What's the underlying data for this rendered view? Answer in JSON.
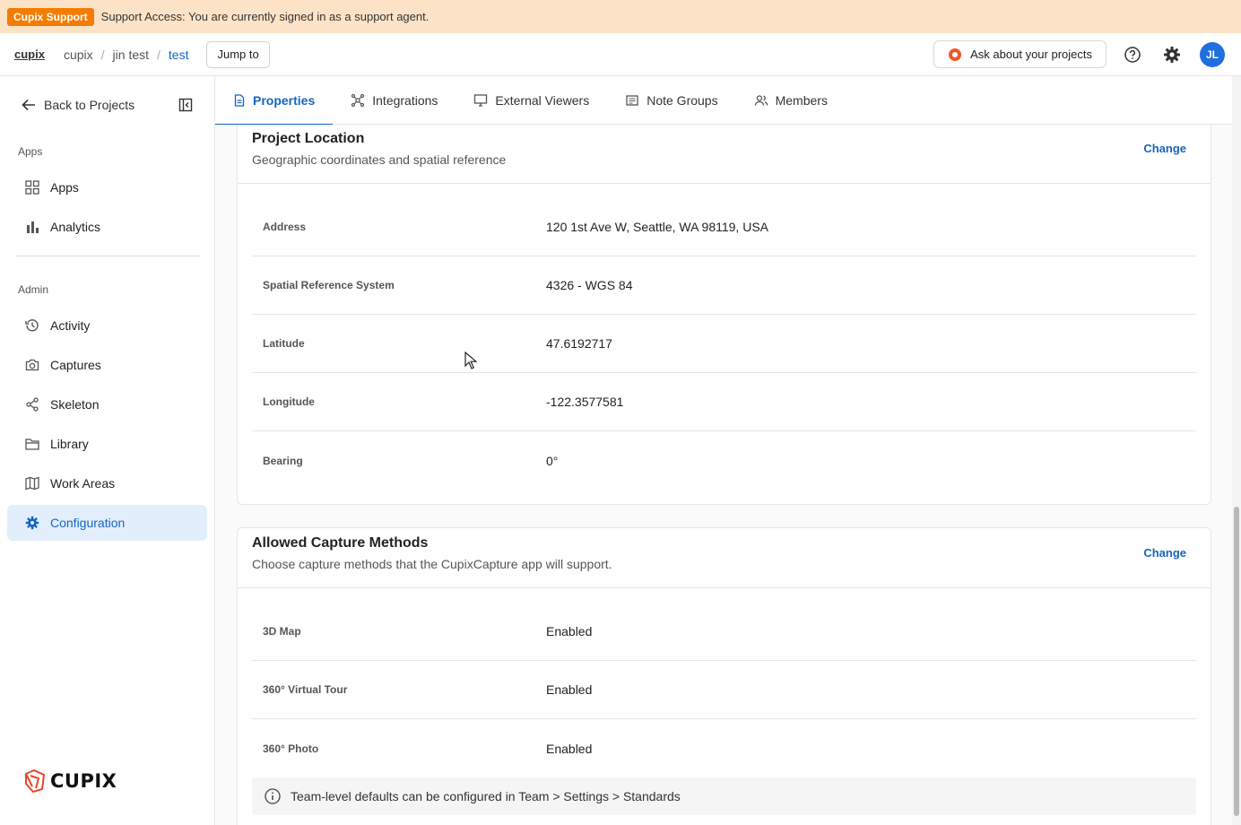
{
  "banner": {
    "badge": "Cupix Support",
    "message": "Support Access: You are currently signed in as a support agent."
  },
  "topnav": {
    "org_link": "cupix",
    "breadcrumbs": [
      "cupix",
      "jin test",
      "test"
    ],
    "jump_label": "Jump to",
    "ask_label": "Ask about your projects",
    "avatar_initials": "JL"
  },
  "sidebar": {
    "back_label": "Back to Projects",
    "apps_section": "Apps",
    "admin_section": "Admin",
    "items": [
      {
        "label": "Apps",
        "icon": "grid-icon"
      },
      {
        "label": "Analytics",
        "icon": "bar-chart-icon"
      },
      {
        "label": "Activity",
        "icon": "history-icon"
      },
      {
        "label": "Captures",
        "icon": "camera-icon"
      },
      {
        "label": "Skeleton",
        "icon": "share-nodes-icon"
      },
      {
        "label": "Library",
        "icon": "folder-icon"
      },
      {
        "label": "Work Areas",
        "icon": "map-icon"
      },
      {
        "label": "Configuration",
        "icon": "gear-icon"
      }
    ],
    "logo_text": "CUPIX"
  },
  "tabs": [
    {
      "label": "Properties",
      "icon": "document-icon"
    },
    {
      "label": "Integrations",
      "icon": "hub-icon"
    },
    {
      "label": "External Viewers",
      "icon": "monitor-icon"
    },
    {
      "label": "Note Groups",
      "icon": "notes-icon"
    },
    {
      "label": "Members",
      "icon": "people-icon"
    }
  ],
  "location": {
    "title": "Project Location",
    "subtitle": "Geographic coordinates and spatial reference",
    "change_label": "Change",
    "rows": [
      {
        "label": "Address",
        "value": "120 1st Ave W, Seattle, WA 98119, USA"
      },
      {
        "label": "Spatial Reference System",
        "value": "4326 - WGS 84"
      },
      {
        "label": "Latitude",
        "value": "47.6192717"
      },
      {
        "label": "Longitude",
        "value": "-122.3577581"
      },
      {
        "label": "Bearing",
        "value": "0°"
      }
    ]
  },
  "capture": {
    "title": "Allowed Capture Methods",
    "subtitle": "Choose capture methods that the CupixCapture app will support.",
    "change_label": "Change",
    "rows": [
      {
        "label": "3D Map",
        "value": "Enabled"
      },
      {
        "label": "360° Virtual Tour",
        "value": "Enabled"
      },
      {
        "label": "360° Photo",
        "value": "Enabled"
      }
    ],
    "info": "Team-level defaults can be configured in Team > Settings > Standards"
  },
  "colors": {
    "accent": "#1565c0",
    "banner_bg": "#fce3c7",
    "badge": "#f57c00",
    "active_bg": "#e3eefd"
  }
}
